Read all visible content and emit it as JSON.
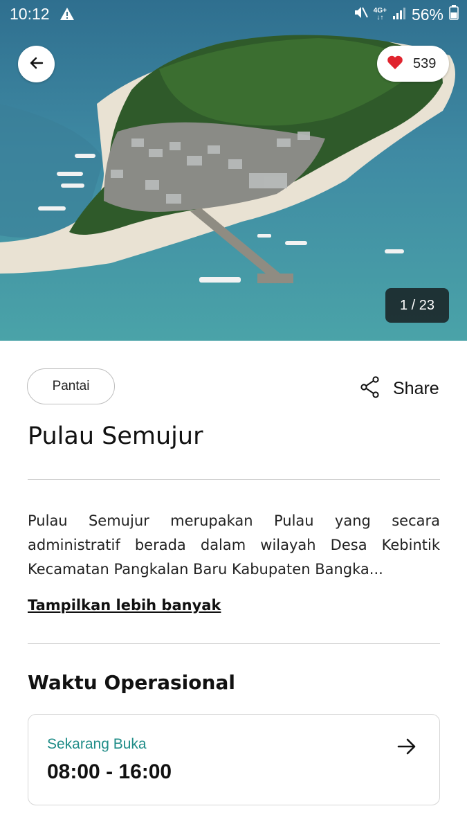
{
  "status_bar": {
    "time": "10:12",
    "network": "4G+",
    "battery": "56%",
    "icons": [
      "warning-icon",
      "mute-icon",
      "signal-icon",
      "battery-icon"
    ]
  },
  "gallery": {
    "likes": "539",
    "counter": "1 / 23",
    "icons": [
      "back-arrow-icon",
      "heart-icon"
    ]
  },
  "place": {
    "category": "Pantai",
    "share_label": "Share",
    "name": "Pulau Semujur",
    "description": "Pulau Semujur merupakan Pulau yang secara administratif berada dalam wilayah Desa Kebintik Kecamatan Pangkalan Baru Kabupaten Bangka...",
    "show_more": "Tampilkan lebih banyak"
  },
  "operational": {
    "section_title": "Waktu Operasional",
    "status": "Sekarang Buka",
    "hours": "08:00 - 16:00"
  },
  "colors": {
    "accent_teal": "#1f8c87",
    "heart_red": "#e0242e",
    "divider": "#cfcfcf"
  }
}
